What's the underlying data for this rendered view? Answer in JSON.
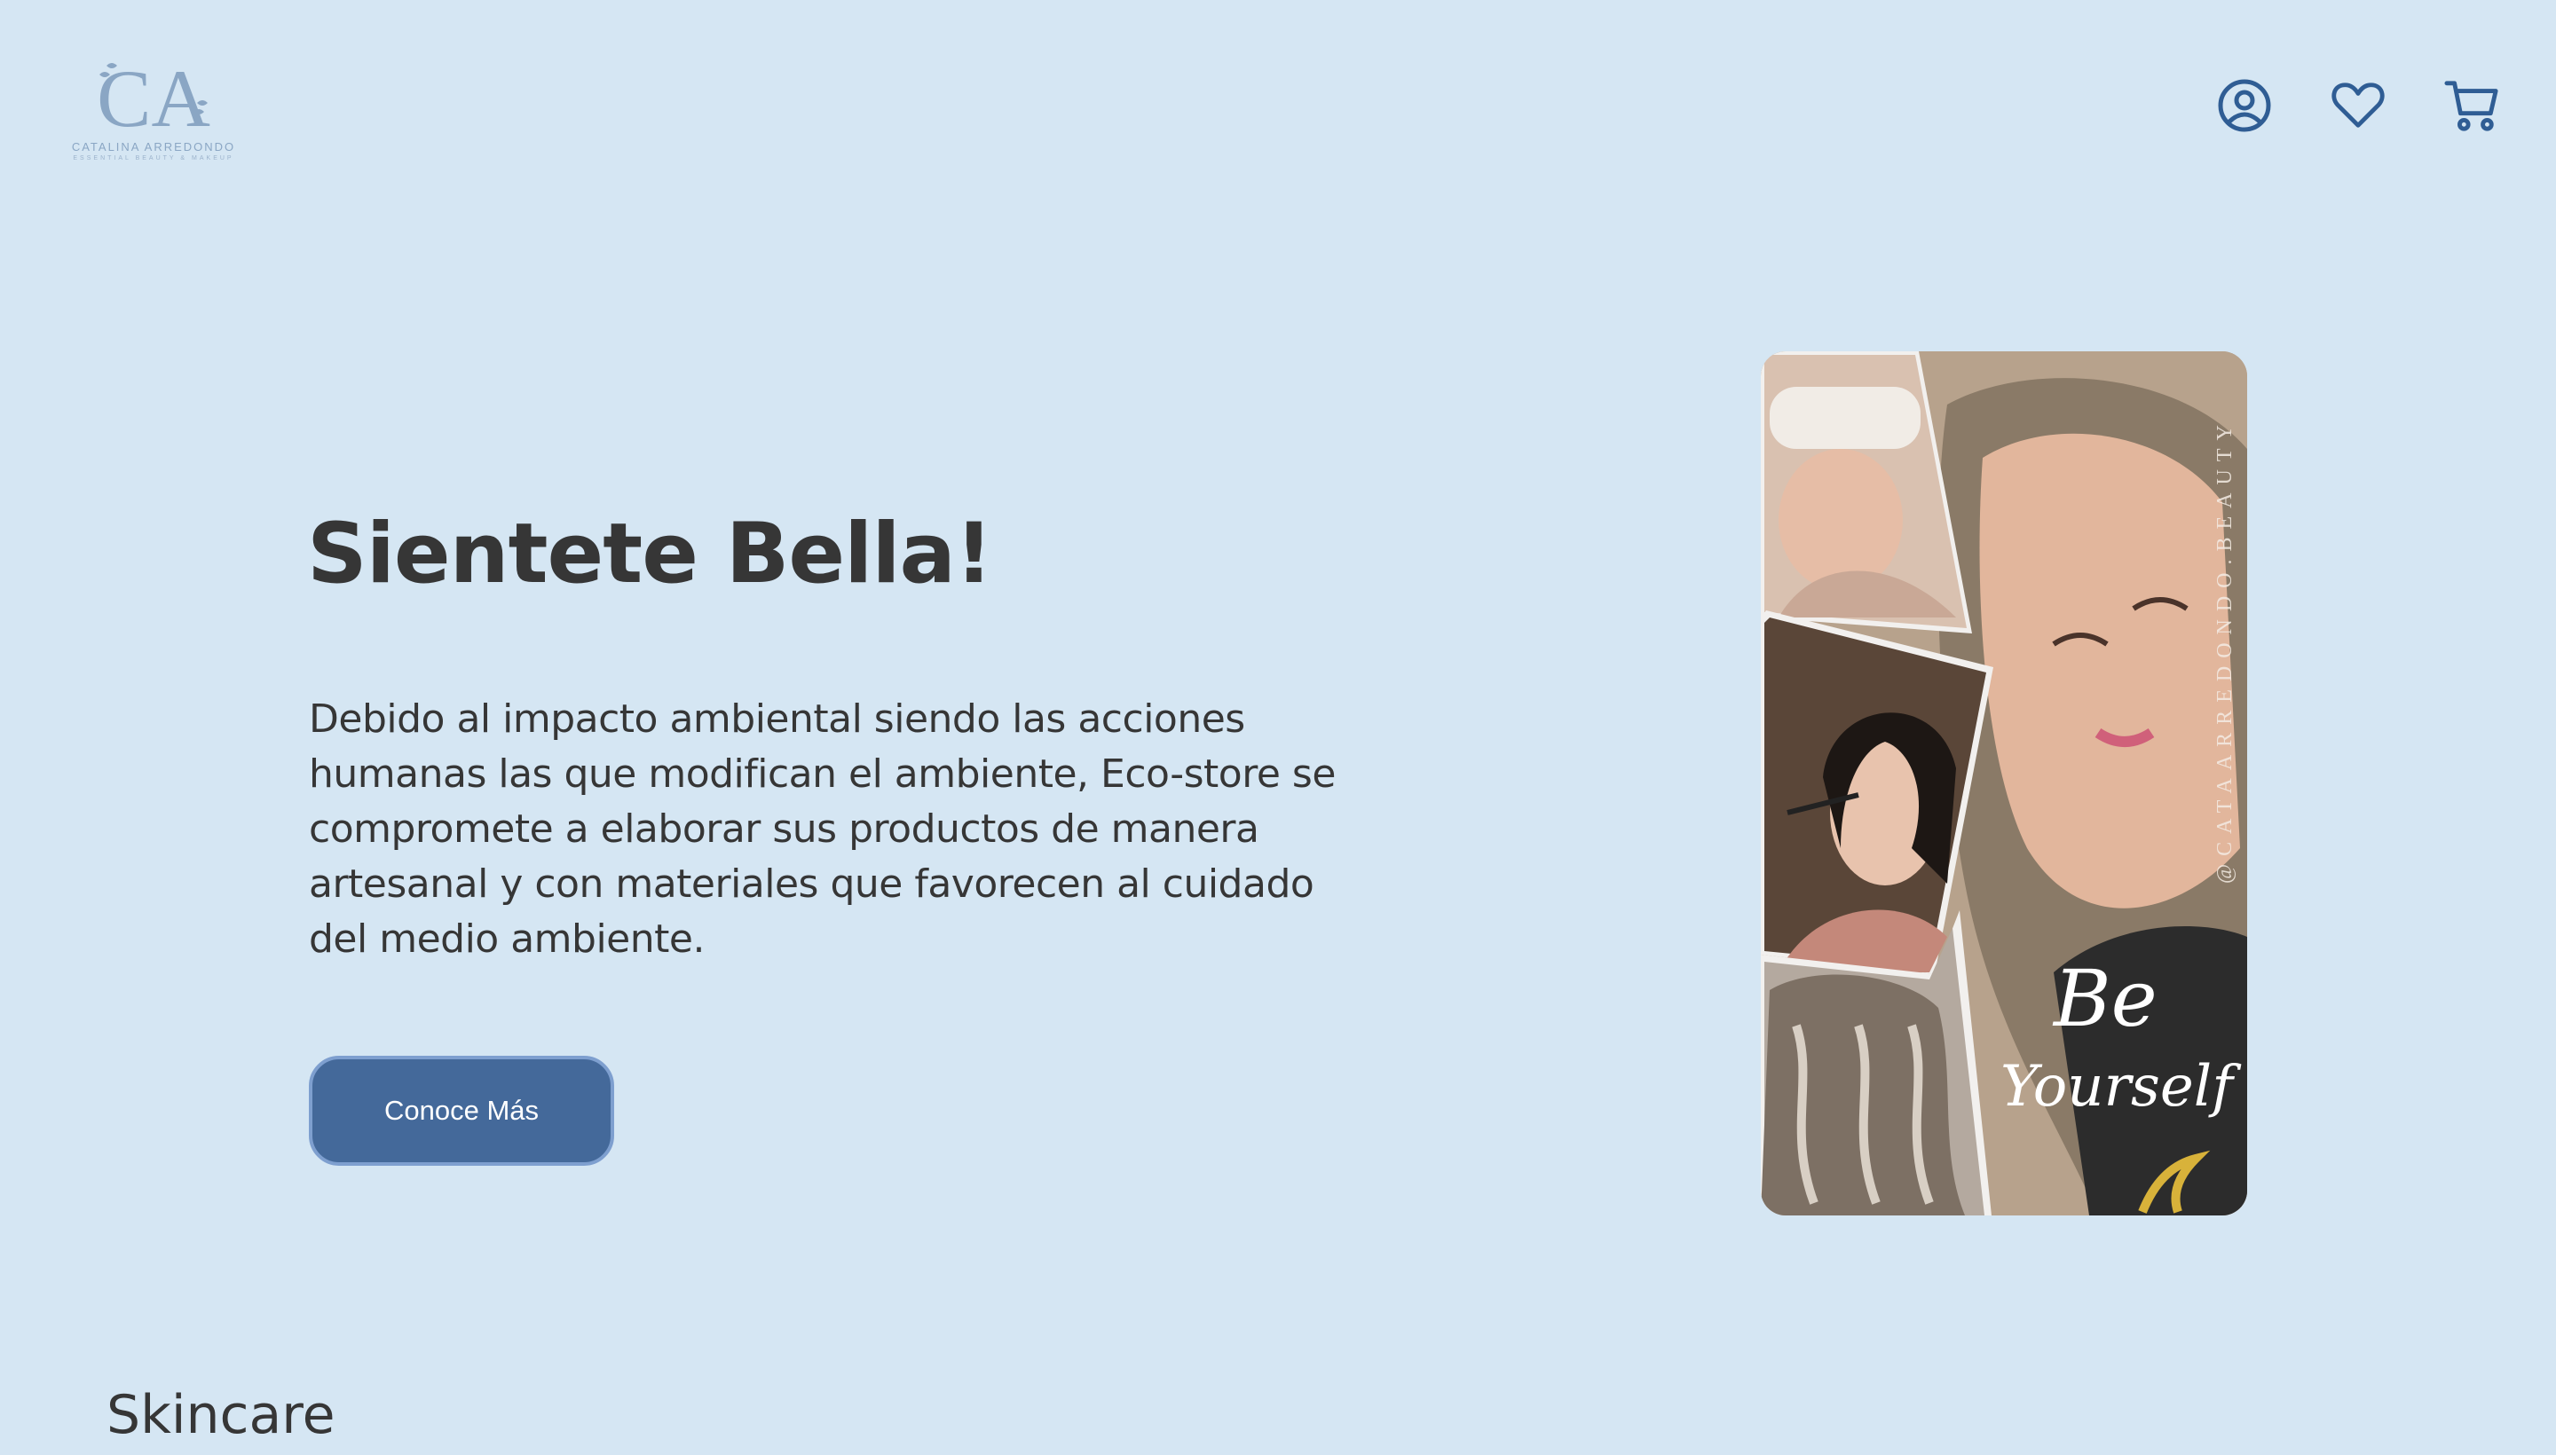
{
  "header": {
    "logo": {
      "monogram": "CA",
      "name": "CATALINA ARREDONDO",
      "tagline": "ESSENTIAL BEAUTY & MAKEUP"
    },
    "icons": [
      "user-circle-icon",
      "heart-icon",
      "cart-icon"
    ]
  },
  "hero": {
    "title": "Sientete Bella!",
    "text": "Debido al impacto ambiental siendo las acciones humanas las que modifican el ambiente, Eco-store se compromete a elaborar sus productos de manera artesanal y con materiales que favorecen al cuidado del medio ambiente.",
    "button_label": "Conoce Más"
  },
  "collage": {
    "watermark": "@CATAARREDONDO.BEAUTY",
    "script_text_1": "Be",
    "script_text_2": "Yourself"
  },
  "sections": {
    "skincare_title": "Skincare"
  },
  "colors": {
    "background": "#d5e6f3",
    "accent": "#44699a",
    "icon": "#2f5d94",
    "text": "#363636"
  }
}
